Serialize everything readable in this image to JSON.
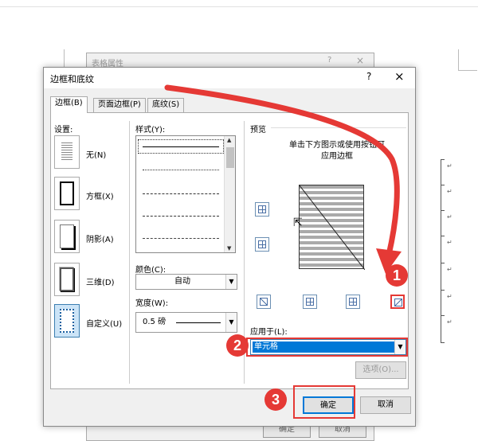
{
  "background_dialog": {
    "title": "表格属性",
    "help": "?",
    "close": "×",
    "ok_label": "确定",
    "cancel_label": "取消"
  },
  "paragraph_mark": "↵",
  "dialog": {
    "title": "边框和底纹",
    "help": "?",
    "close": "×",
    "tabs": [
      {
        "label": "边框(B)",
        "active": true
      },
      {
        "label": "页面边框(P)",
        "active": false
      },
      {
        "label": "底纹(S)",
        "active": false
      }
    ],
    "setting_label": "设置:",
    "settings": [
      {
        "label": "无(N)"
      },
      {
        "label": "方框(X)"
      },
      {
        "label": "阴影(A)"
      },
      {
        "label": "三维(D)"
      },
      {
        "label": "自定义(U)",
        "selected": true
      }
    ],
    "style_label": "样式(Y):",
    "color_label": "颜色(C):",
    "color_value": "自动",
    "width_label": "宽度(W):",
    "width_value": "0.5 磅",
    "preview_label": "预览",
    "preview_hint_line1": "单击下方图示或使用按钮可",
    "preview_hint_line2": "应用边框",
    "apply_to_label": "应用于(L):",
    "apply_to_value": "单元格",
    "options_button": "选项(O)...",
    "ok_button": "确定",
    "cancel_button": "取消"
  },
  "annotations": [
    {
      "number": "1"
    },
    {
      "number": "2"
    },
    {
      "number": "3"
    }
  ],
  "colors": {
    "annotation_red": "#e53935",
    "selection_blue": "#0078d7",
    "dialog_bg": "#f0f0f0"
  }
}
